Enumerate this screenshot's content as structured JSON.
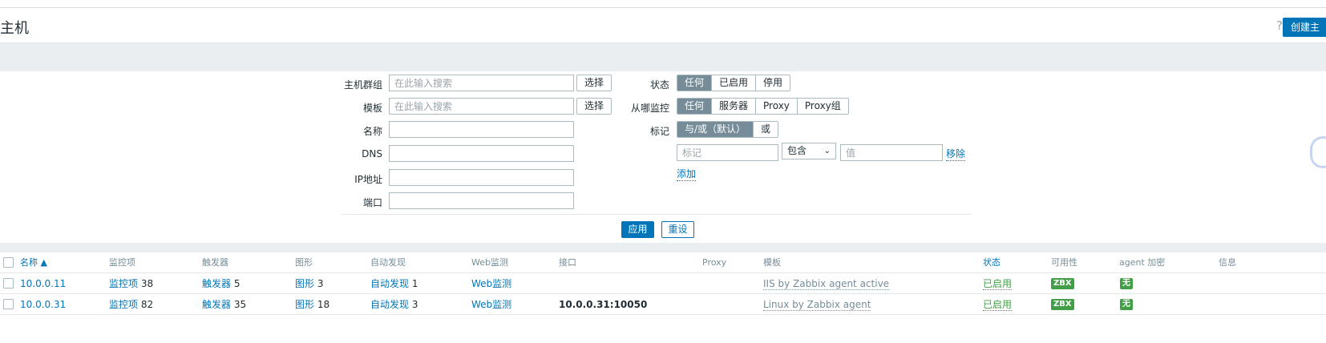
{
  "header": {
    "title": "主机",
    "help": "?",
    "create_label": "创建主"
  },
  "filter": {
    "hostgroup_label": "主机群组",
    "hostgroup_placeholder": "在此输入搜索",
    "template_label": "模板",
    "template_placeholder": "在此输入搜索",
    "select_label": "选择",
    "name_label": "名称",
    "dns_label": "DNS",
    "ip_label": "IP地址",
    "port_label": "端口",
    "status_label": "状态",
    "status_options": [
      "任何",
      "已启用",
      "停用"
    ],
    "monitored_by_label": "从哪监控",
    "monitored_by_options": [
      "任何",
      "服务器",
      "Proxy",
      "Proxy组"
    ],
    "tags_label": "标记",
    "tags_options": [
      "与/或（默认）",
      "或"
    ],
    "tag_placeholder": "标记",
    "tag_operator": "包含",
    "tag_value_placeholder": "值",
    "remove_label": "移除",
    "add_label": "添加",
    "apply_label": "应用",
    "reset_label": "重设"
  },
  "table": {
    "headers": {
      "name": "名称 ▲",
      "items": "监控项",
      "triggers": "触发器",
      "graphs": "图形",
      "discovery": "自动发现",
      "web": "Web监测",
      "interface": "接口",
      "proxy": "Proxy",
      "templates": "模板",
      "status": "状态",
      "availability": "可用性",
      "encryption": "agent 加密",
      "info": "信息"
    },
    "rows": [
      {
        "name": "10.0.0.11",
        "items_label": "监控项",
        "items_count": "38",
        "triggers_label": "触发器",
        "triggers_count": "5",
        "graphs_label": "图形",
        "graphs_count": "3",
        "discovery_label": "自动发现",
        "discovery_count": "1",
        "web": "Web监测",
        "interface": "",
        "template": "IIS by Zabbix agent active",
        "status": "已启用",
        "availability": "ZBX",
        "encryption": "无"
      },
      {
        "name": "10.0.0.31",
        "items_label": "监控项",
        "items_count": "82",
        "triggers_label": "触发器",
        "triggers_count": "35",
        "graphs_label": "图形",
        "graphs_count": "18",
        "discovery_label": "自动发现",
        "discovery_count": "3",
        "web": "Web监测",
        "interface": "10.0.0.31:10050",
        "template": "Linux by Zabbix agent",
        "status": "已启用",
        "availability": "ZBX",
        "encryption": "无"
      }
    ]
  },
  "colors": {
    "accent": "#0275b8",
    "green": "#429e47",
    "segment_active": "#768d99",
    "band": "#ebeef0"
  }
}
